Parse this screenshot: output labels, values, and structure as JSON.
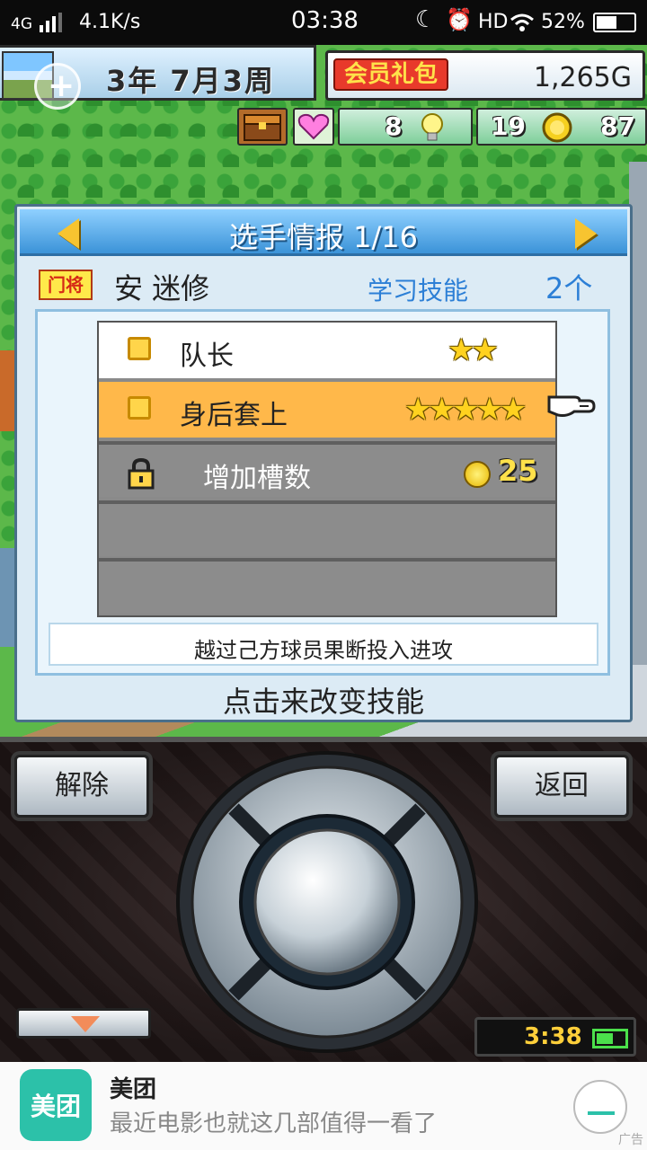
{
  "status_bar": {
    "network": "4G",
    "speed": "4.1K/s",
    "time": "03:38",
    "hd": "HD",
    "battery": "52%"
  },
  "hud": {
    "date": "3年 7月3周",
    "vip_pack": "会员礼包",
    "money": "1,265G",
    "hearts": "8",
    "ideas": "19",
    "coins": "87"
  },
  "panel": {
    "title": "选手情报 1/16",
    "position_badge": "门将",
    "player_name": "安 迷修",
    "learn_label": "学习技能",
    "learn_count": "2个",
    "skills": [
      {
        "label": "队长",
        "stars": "★★",
        "star_count": 2,
        "selected": false
      },
      {
        "label": "身后套上",
        "stars": "★★★★★",
        "star_count": 5,
        "selected": true
      }
    ],
    "add_slot": {
      "label": "增加槽数",
      "cost": "25"
    },
    "description": "越过己方球员果断投入进攻",
    "hint": "点击来改变技能"
  },
  "controls": {
    "release": "解除",
    "back": "返回",
    "clock": "3:38"
  },
  "ad": {
    "logo_text": "美团",
    "title": "美团",
    "text": "最近电影也就这几部值得一看了",
    "tag": "广告"
  },
  "colors": {
    "panel_bg": "#dcebf5",
    "title_bar": "#3b93d8",
    "selected_row": "#ffb84a",
    "accent_text": "#2c7fd6",
    "meituan": "#2cc1a9"
  }
}
